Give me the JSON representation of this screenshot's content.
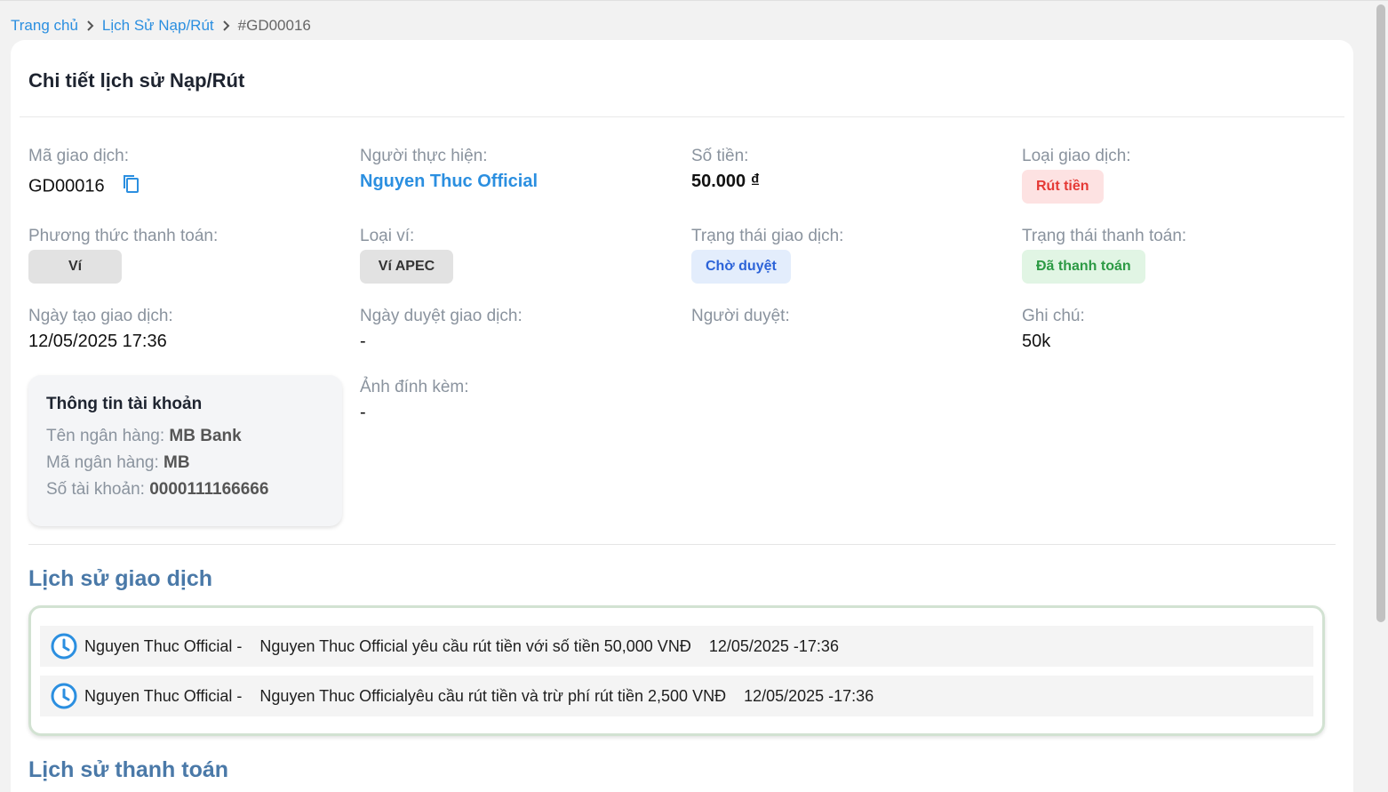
{
  "breadcrumb": {
    "home": "Trang chủ",
    "history": "Lịch Sử Nạp/Rút",
    "current": "#GD00016"
  },
  "card": {
    "title": "Chi tiết lịch sử Nạp/Rút"
  },
  "fields": {
    "transaction_code": {
      "label": "Mã giao dịch:",
      "value": "GD00016"
    },
    "performer": {
      "label": "Người thực hiện:",
      "value": "Nguyen Thuc Official"
    },
    "amount": {
      "label": "Số tiền:",
      "value": "50.000 ₫"
    },
    "transaction_type": {
      "label": "Loại giao dịch:",
      "value": "Rút tiền"
    },
    "payment_method": {
      "label": "Phương thức thanh toán:",
      "value": "Ví"
    },
    "wallet_type": {
      "label": "Loại ví:",
      "value": "Ví APEC"
    },
    "transaction_status": {
      "label": "Trạng thái giao dịch:",
      "value": "Chờ duyệt"
    },
    "payment_status": {
      "label": "Trạng thái thanh toán:",
      "value": "Đã thanh toán"
    },
    "created_date": {
      "label": "Ngày tạo giao dịch:",
      "value": "12/05/2025 17:36"
    },
    "approved_date": {
      "label": "Ngày duyệt giao dịch:",
      "value": "-"
    },
    "approver": {
      "label": "Người duyệt:",
      "value": ""
    },
    "note": {
      "label": "Ghi chú:",
      "value": "50k"
    },
    "attachment": {
      "label": "Ảnh đính kèm:",
      "value": "-"
    }
  },
  "account_info": {
    "title": "Thông tin tài khoản",
    "bank_name_label": "Tên ngân hàng:",
    "bank_name": "MB Bank",
    "bank_code_label": "Mã ngân hàng:",
    "bank_code": "MB",
    "account_number_label": "Số tài khoản:",
    "account_number": "0000111166666"
  },
  "transaction_history": {
    "title": "Lịch sử giao dịch",
    "items": [
      {
        "actor": "Nguyen Thuc Official -",
        "message": "Nguyen Thuc Official yêu cầu rút tiền với số tiền 50,000 VNĐ",
        "time": "12/05/2025 -17:36"
      },
      {
        "actor": "Nguyen Thuc Official -",
        "message": "Nguyen Thuc Officialyêu cầu rút tiền và trừ phí rút tiền 2,500 VNĐ",
        "time": "12/05/2025 -17:36"
      }
    ]
  },
  "payment_history": {
    "title": "Lịch sử thanh toán"
  },
  "colors": {
    "link": "#2b8fe0",
    "section_title": "#4a79a8",
    "danger": "#e53935",
    "info": "#2c63d8",
    "success": "#2c9a44"
  }
}
